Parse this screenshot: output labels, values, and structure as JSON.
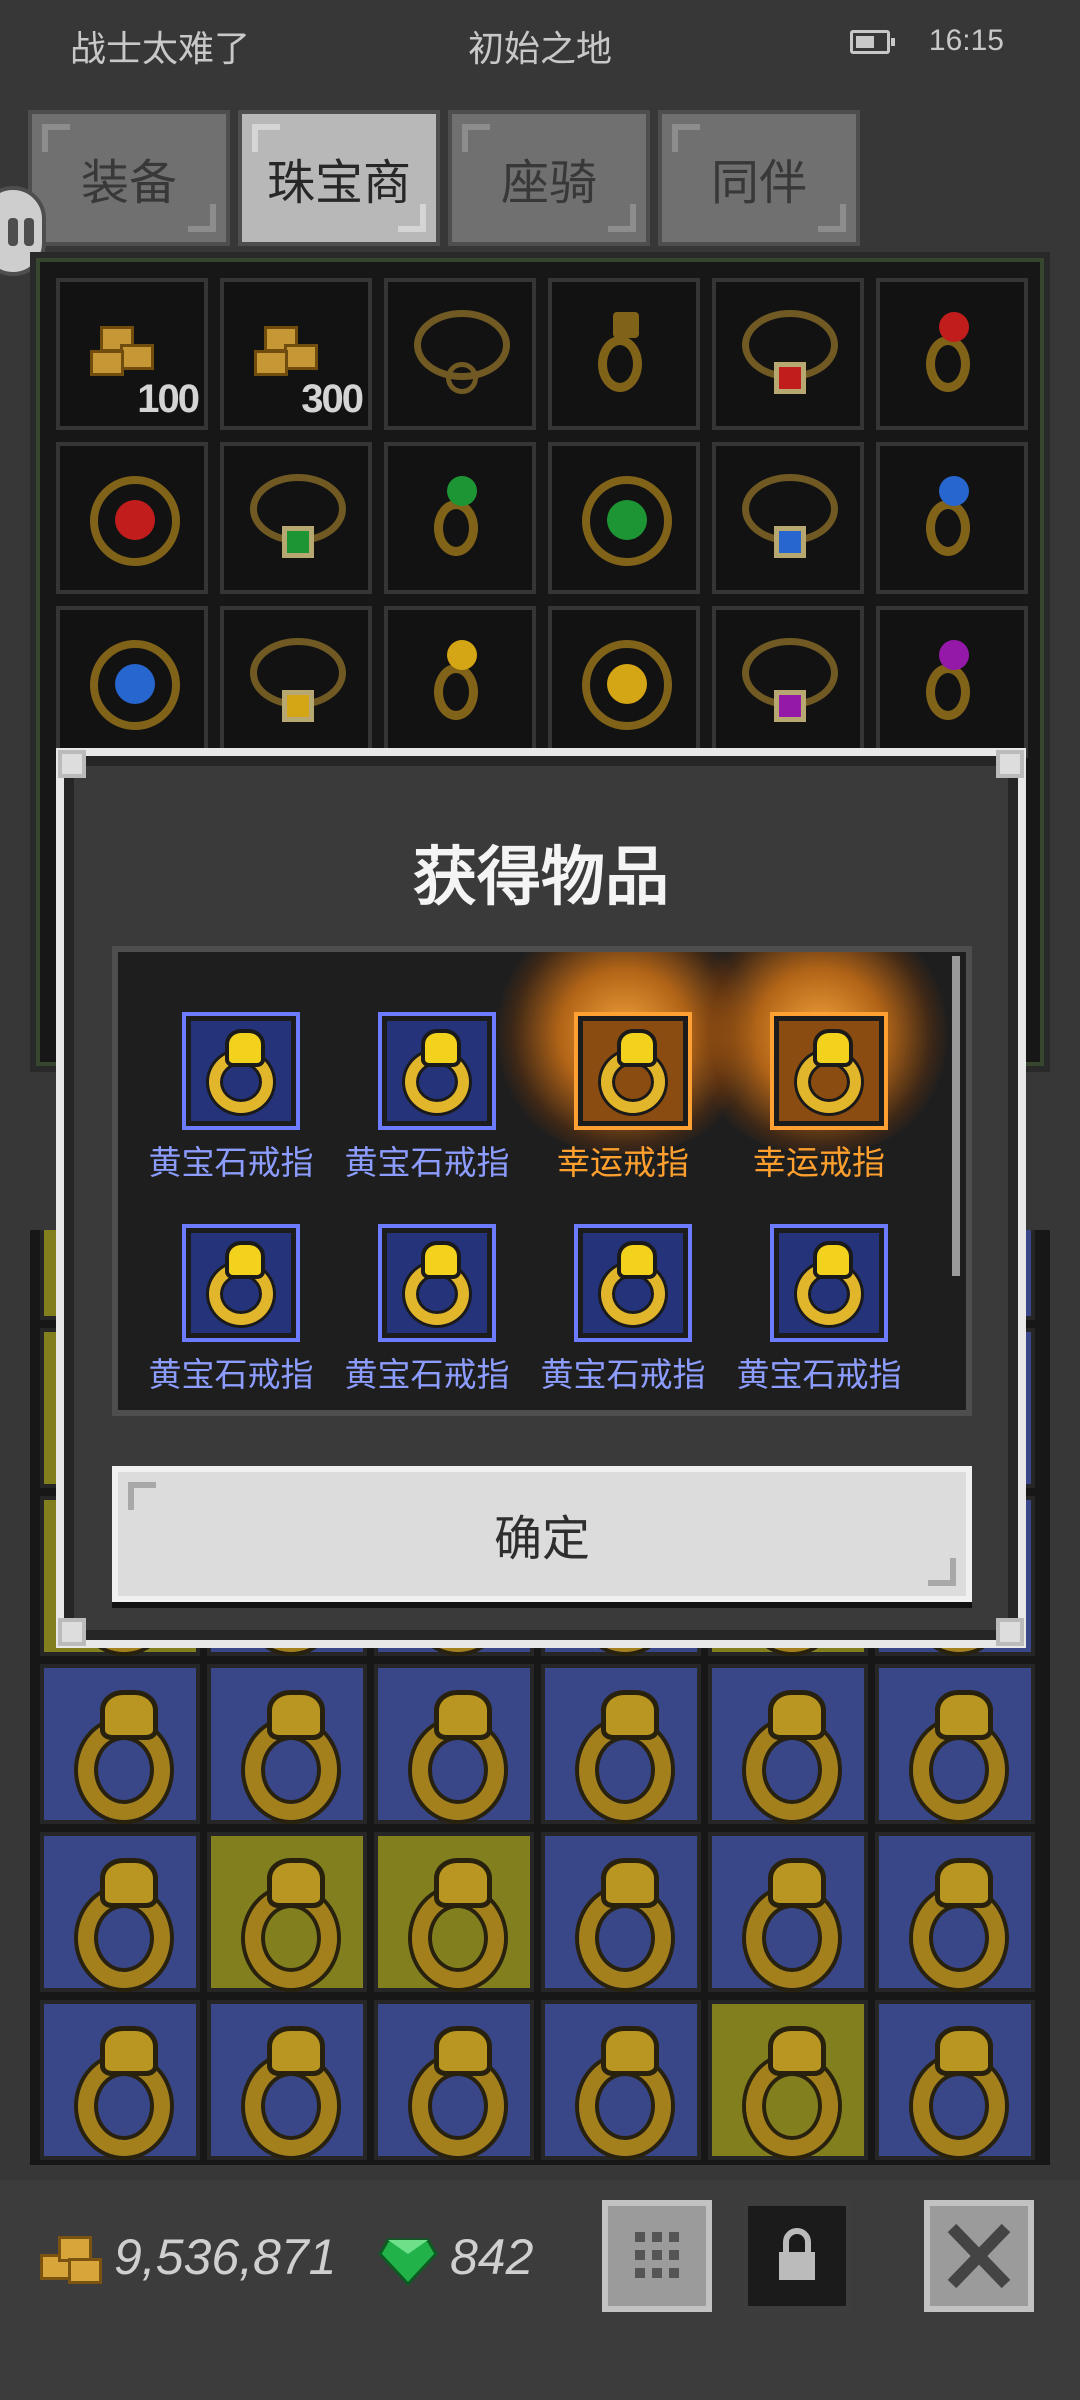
{
  "status_bar": {
    "left_text": "战士太难了",
    "center_text": "初始之地",
    "time": "16:15",
    "battery_icon": "battery-icon"
  },
  "tabs": [
    {
      "label": "装备",
      "active": false
    },
    {
      "label": "珠宝商",
      "active": true
    },
    {
      "label": "座骑",
      "active": false
    },
    {
      "label": "同伴",
      "active": false
    }
  ],
  "shop": {
    "slot_quantities": {
      "gold_small": "100",
      "gold_large": "300"
    },
    "gem_colors": {
      "ruby": "#d32020",
      "emerald": "#21a23a",
      "sapphire": "#2a6fe0",
      "topaz": "#e6b316",
      "amethyst": "#a21cb8"
    }
  },
  "dialog": {
    "title": "获得物品",
    "items": [
      {
        "label": "黄宝石戒指",
        "rarity": "rare"
      },
      {
        "label": "黄宝石戒指",
        "rarity": "rare"
      },
      {
        "label": "幸运戒指",
        "rarity": "lucky"
      },
      {
        "label": "幸运戒指",
        "rarity": "lucky"
      },
      {
        "label": "黄宝石戒指",
        "rarity": "rare"
      },
      {
        "label": "黄宝石戒指",
        "rarity": "rare"
      },
      {
        "label": "黄宝石戒指",
        "rarity": "rare"
      },
      {
        "label": "黄宝石戒指",
        "rarity": "rare"
      }
    ],
    "confirm_label": "确定",
    "colors": {
      "rare_label": "#8c9dff",
      "lucky_label": "#ffa02e"
    }
  },
  "footer": {
    "gold_amount": "9,536,871",
    "gem_amount": "842",
    "buttons": [
      "grid-icon",
      "lock-icon",
      "close-icon"
    ]
  }
}
